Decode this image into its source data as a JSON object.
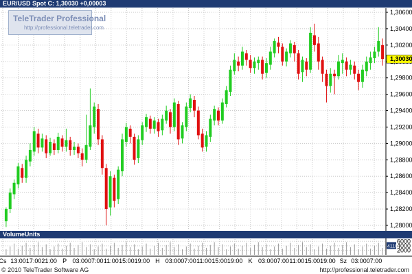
{
  "header": {
    "title": "EUR/USD Spot C: 1,30030 +0,00003"
  },
  "watermark": {
    "brand": "TeleTrader Professional",
    "url": "http://professional.teletrader.com"
  },
  "price_axis": {
    "ticks": [
      "1,30600",
      "1,30400",
      "1,30200",
      "1,30000",
      "1,29800",
      "1,29600",
      "1,29400",
      "1,29200",
      "1,29000",
      "1,28800",
      "1,28600",
      "1,28400",
      "1,28200",
      "1,28000"
    ],
    "current_label": "1,30030"
  },
  "volume_panel": {
    "title": "VolumeUnits",
    "ticks": [
      "6000",
      "4000",
      "2000"
    ],
    "current_label": "4118"
  },
  "time_axis": {
    "labels": [
      "Cs",
      "13:00",
      "17:00",
      "21:00",
      "P",
      "03:00",
      "07:00",
      "11:00",
      "15:00",
      "19:00",
      "H",
      "03:00",
      "07:00",
      "11:00",
      "15:00",
      "19:00",
      "K",
      "03:00",
      "07:00",
      "11:00",
      "15:00",
      "19:00",
      "Sz",
      "03:00",
      "07:00"
    ]
  },
  "footer": {
    "copyright": "© 2010 TeleTrader Software AG",
    "website": "http://professional.teletrader.com"
  },
  "colors": {
    "up": "#21cc21",
    "down": "#e01010",
    "grid": "#c8c8c8",
    "header_bg": "#1f3b73",
    "price_tag": "#ffff00"
  },
  "chart_data": {
    "type": "candlestick",
    "title": "EUR/USD Spot C: 1,30030 +0,00003",
    "ylim": [
      1.2795,
      1.3065
    ],
    "y_ticks": [
      1.306,
      1.304,
      1.302,
      1.3,
      1.298,
      1.296,
      1.294,
      1.292,
      1.29,
      1.288,
      1.286,
      1.284,
      1.282,
      1.28
    ],
    "last_price": 1.3003,
    "change": 3e-05,
    "volume_ylim": [
      0,
      7000
    ],
    "volume_ticks": [
      6000,
      4000,
      2000
    ],
    "last_volume": 4118,
    "grid": true,
    "candles": [
      [
        1.2805,
        1.282,
        1.2798,
        1.2822
      ],
      [
        1.282,
        1.284,
        1.2815,
        1.2845
      ],
      [
        1.2838,
        1.2852,
        1.2832,
        1.2856
      ],
      [
        1.285,
        1.2872,
        1.2845,
        1.2876
      ],
      [
        1.287,
        1.2858,
        1.2852,
        1.2875
      ],
      [
        1.2858,
        1.288,
        1.2852,
        1.2885
      ],
      [
        1.2878,
        1.2892,
        1.2872,
        1.29
      ],
      [
        1.289,
        1.2915,
        1.2885,
        1.292
      ],
      [
        1.2912,
        1.2895,
        1.2888,
        1.2918
      ],
      [
        1.2895,
        1.2906,
        1.289,
        1.2912
      ],
      [
        1.2905,
        1.2888,
        1.2882,
        1.291
      ],
      [
        1.2888,
        1.2902,
        1.2885,
        1.2907
      ],
      [
        1.29,
        1.2892,
        1.2886,
        1.2905
      ],
      [
        1.2892,
        1.2908,
        1.2888,
        1.2913
      ],
      [
        1.2906,
        1.2896,
        1.289,
        1.291
      ],
      [
        1.2896,
        1.2904,
        1.289,
        1.2918
      ],
      [
        1.2904,
        1.2892,
        1.2885,
        1.2908
      ],
      [
        1.2892,
        1.2896,
        1.2886,
        1.2902
      ],
      [
        1.2896,
        1.2888,
        1.2882,
        1.29
      ],
      [
        1.2888,
        1.288,
        1.2872,
        1.2894
      ],
      [
        1.288,
        1.2898,
        1.2876,
        1.2935
      ],
      [
        1.2896,
        1.2922,
        1.2892,
        1.2967
      ],
      [
        1.292,
        1.2945,
        1.2912,
        1.295
      ],
      [
        1.2942,
        1.2905,
        1.2898,
        1.2948
      ],
      [
        1.2905,
        1.287,
        1.2862,
        1.291
      ],
      [
        1.287,
        1.282,
        1.28,
        1.2875
      ],
      [
        1.2822,
        1.286,
        1.2812,
        1.2866
      ],
      [
        1.2858,
        1.283,
        1.2822,
        1.2862
      ],
      [
        1.2832,
        1.2868,
        1.2826,
        1.2872
      ],
      [
        1.2866,
        1.2905,
        1.286,
        1.2912
      ],
      [
        1.2902,
        1.292,
        1.2896,
        1.2925
      ],
      [
        1.2918,
        1.2908,
        1.29,
        1.2922
      ],
      [
        1.2908,
        1.288,
        1.2874,
        1.2912
      ],
      [
        1.2882,
        1.2905,
        1.2876,
        1.291
      ],
      [
        1.2904,
        1.2922,
        1.2898,
        1.2926
      ],
      [
        1.292,
        1.2932,
        1.2914,
        1.2936
      ],
      [
        1.293,
        1.2918,
        1.2912,
        1.2934
      ],
      [
        1.2918,
        1.2928,
        1.2912,
        1.2932
      ],
      [
        1.2926,
        1.2915,
        1.2908,
        1.293
      ],
      [
        1.2916,
        1.293,
        1.291,
        1.2935
      ],
      [
        1.2928,
        1.294,
        1.2924,
        1.2946
      ],
      [
        1.2938,
        1.292,
        1.2912,
        1.2942
      ],
      [
        1.292,
        1.295,
        1.2915,
        1.2955
      ],
      [
        1.2948,
        1.2905,
        1.2898,
        1.2952
      ],
      [
        1.2906,
        1.2922,
        1.29,
        1.2926
      ],
      [
        1.292,
        1.2945,
        1.2915,
        1.295
      ],
      [
        1.2943,
        1.2955,
        1.2938,
        1.296
      ],
      [
        1.2953,
        1.294,
        1.2932,
        1.2958
      ],
      [
        1.294,
        1.291,
        1.2905,
        1.2945
      ],
      [
        1.2912,
        1.2895,
        1.289,
        1.2918
      ],
      [
        1.2896,
        1.291,
        1.289,
        1.2915
      ],
      [
        1.2908,
        1.293,
        1.2902,
        1.2935
      ],
      [
        1.2928,
        1.2942,
        1.2922,
        1.2946
      ],
      [
        1.294,
        1.2928,
        1.2922,
        1.2944
      ],
      [
        1.2928,
        1.295,
        1.2924,
        1.2955
      ],
      [
        1.2948,
        1.2965,
        1.2944,
        1.297
      ],
      [
        1.2963,
        1.299,
        1.2958,
        1.2995
      ],
      [
        1.2988,
        1.3002,
        1.2984,
        1.301
      ],
      [
        1.3,
        1.2995,
        1.2988,
        1.3006
      ],
      [
        1.2995,
        1.3012,
        1.299,
        1.3018
      ],
      [
        1.301,
        1.3002,
        1.2995,
        1.3014
      ],
      [
        1.3002,
        1.2992,
        1.2986,
        1.3008
      ],
      [
        1.2992,
        1.3,
        1.2985,
        1.3005
      ],
      [
        1.2998,
        1.3002,
        1.299,
        1.3006
      ],
      [
        1.3002,
        1.2985,
        1.2978,
        1.3006
      ],
      [
        1.2986,
        1.2998,
        1.298,
        1.3004
      ],
      [
        1.2996,
        1.3012,
        1.299,
        1.3018
      ],
      [
        1.301,
        1.3025,
        1.3005,
        1.3028
      ],
      [
        1.3023,
        1.3018,
        1.301,
        1.303
      ],
      [
        1.3018,
        1.3,
        1.2995,
        1.3022
      ],
      [
        1.3,
        1.3012,
        1.2994,
        1.3016
      ],
      [
        1.301,
        1.3022,
        1.3005,
        1.3026
      ],
      [
        1.302,
        1.301,
        1.3,
        1.3024
      ],
      [
        1.301,
        1.2985,
        1.2978,
        1.3014
      ],
      [
        1.2987,
        1.3002,
        1.2975,
        1.3006
      ],
      [
        1.3,
        1.299,
        1.2982,
        1.3004
      ],
      [
        1.299,
        1.3035,
        1.2986,
        1.3042
      ],
      [
        1.3032,
        1.302,
        1.3012,
        1.3046
      ],
      [
        1.3022,
        1.3,
        1.299,
        1.303
      ],
      [
        1.3002,
        1.2985,
        1.2975,
        1.3006
      ],
      [
        1.2985,
        1.297,
        1.295,
        1.299
      ],
      [
        1.297,
        1.2985,
        1.2962,
        1.2992
      ],
      [
        1.2985,
        1.2982,
        1.296,
        1.299
      ],
      [
        1.2982,
        1.3,
        1.2978,
        1.3008
      ],
      [
        1.2998,
        1.3002,
        1.2985,
        1.301
      ],
      [
        1.3,
        1.299,
        1.2982,
        1.3005
      ],
      [
        1.299,
        1.2996,
        1.2984,
        1.3002
      ],
      [
        1.2995,
        1.2985,
        1.2978,
        1.3
      ],
      [
        1.2985,
        1.2975,
        1.2965,
        1.299
      ],
      [
        1.2975,
        1.299,
        1.2968,
        1.2996
      ],
      [
        1.2988,
        1.3,
        1.2982,
        1.3006
      ],
      [
        1.2998,
        1.3005,
        1.299,
        1.3012
      ],
      [
        1.3004,
        1.3012,
        1.2998,
        1.3018
      ],
      [
        1.3012,
        1.3025,
        1.3006,
        1.3042
      ],
      [
        1.302,
        1.3003,
        1.2995,
        1.3028
      ]
    ]
  }
}
